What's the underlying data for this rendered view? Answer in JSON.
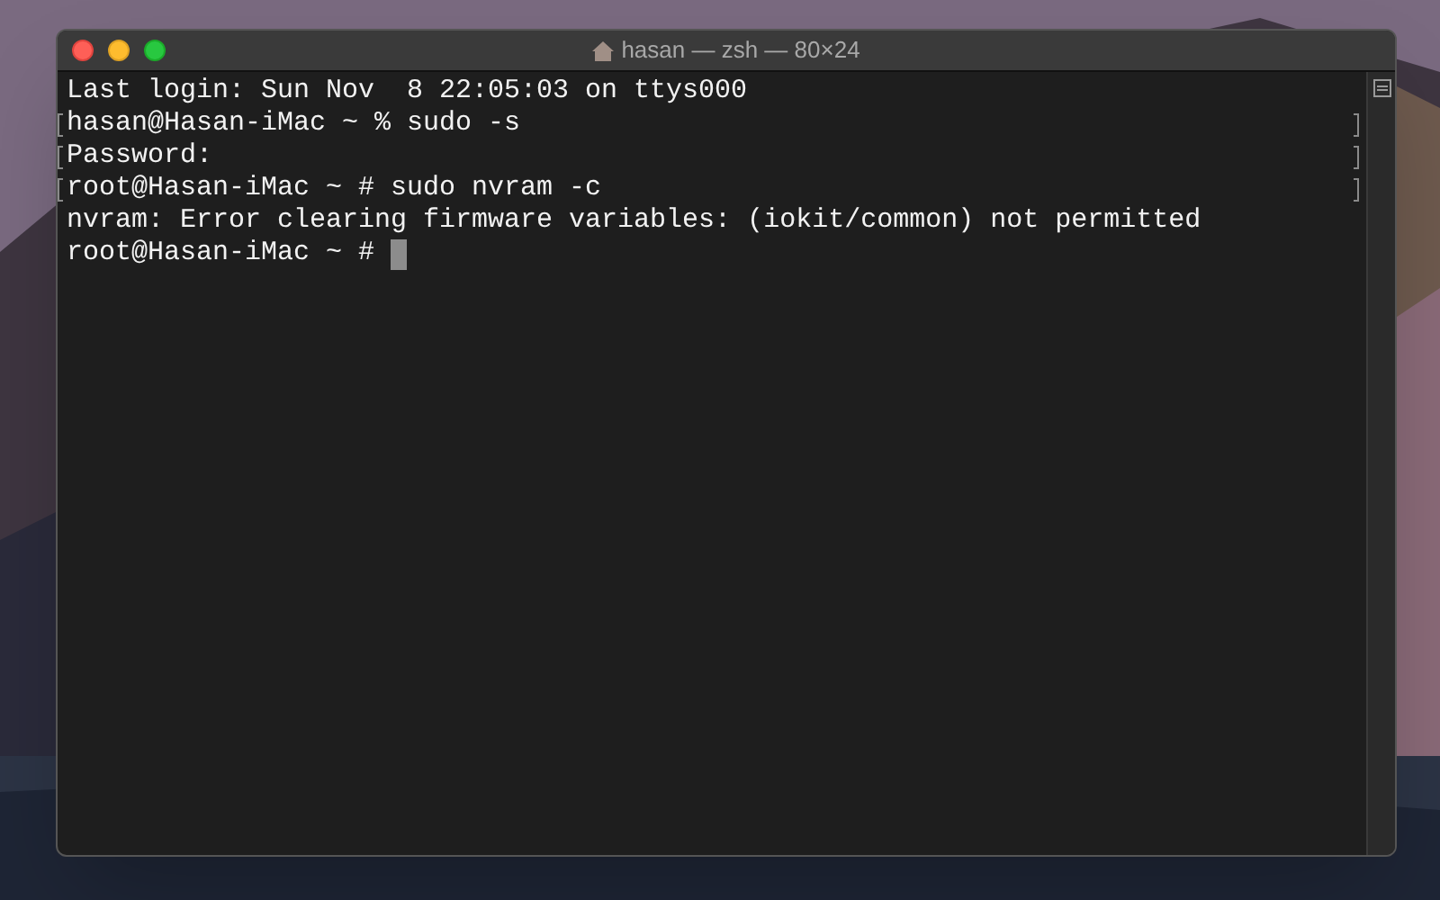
{
  "window": {
    "title": "hasan — zsh — 80×24"
  },
  "lines": [
    {
      "text": "Last login: Sun Nov  8 22:05:03 on ttys000",
      "marked": false,
      "cursor": false
    },
    {
      "text": "hasan@Hasan-iMac ~ % sudo -s",
      "marked": true,
      "cursor": false
    },
    {
      "text": "Password:",
      "marked": true,
      "cursor": false
    },
    {
      "text": "root@Hasan-iMac ~ # sudo nvram -c",
      "marked": true,
      "cursor": false
    },
    {
      "text": "nvram: Error clearing firmware variables: (iokit/common) not permitted",
      "marked": false,
      "cursor": false
    },
    {
      "text": "root@Hasan-iMac ~ # ",
      "marked": false,
      "cursor": true
    }
  ]
}
